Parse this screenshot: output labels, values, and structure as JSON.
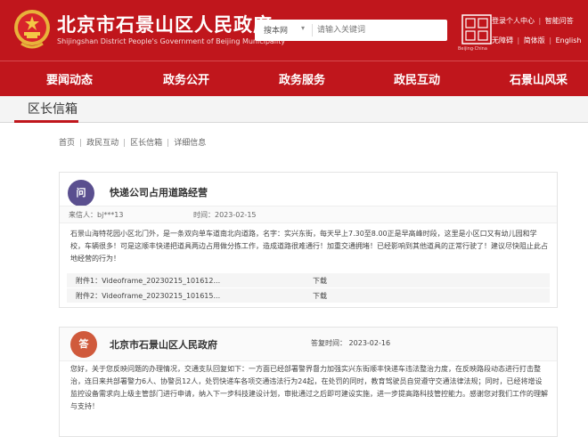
{
  "header": {
    "title": "北京市石景山区人民政府",
    "subtitle": "Shijingshan District People's Government of Beijing Municipality",
    "search": {
      "scope": "搜本网",
      "placeholder": "请输入关键词"
    },
    "city_logo_text": "Beijing·China",
    "links_row1": [
      "登录个人中心",
      "智能问答"
    ],
    "links_row2": [
      "无障碍",
      "简体版",
      "English"
    ]
  },
  "nav": {
    "items": [
      "要闻动态",
      "政务公开",
      "政务服务",
      "政民互动",
      "石景山风采"
    ]
  },
  "section": {
    "title": "区长信箱"
  },
  "breadcrumb": [
    "首页",
    "政民互动",
    "区长信箱",
    "详细信息"
  ],
  "letter": {
    "badge": "问",
    "title": "快递公司占用道路经营",
    "sender_label": "来信人：",
    "sender": "bj***13",
    "time_label": "时间：",
    "time": "2023-02-15",
    "body": "石景山海特花园小区北门外，是一条双向单车道南北向道路，名字：实兴东街，每天早上7.30至8.00正是早高峰时段，这里是小区口又有幼儿园和学校，车辆很多！可是这顺丰快递把道具两边占用做分拣工作，造成道路很难通行！加重交通拥堵！已经影响到其他道具的正常行驶了！建议尽快阻止此占地经营的行为！",
    "attachments": [
      {
        "label": "附件1：",
        "name": "Videoframe_20230215_101612...",
        "action": "下载"
      },
      {
        "label": "附件2：",
        "name": "Videoframe_20230215_101615...",
        "action": "下载"
      }
    ]
  },
  "reply": {
    "badge": "答",
    "org": "北京市石景山区人民政府",
    "time_label": "答复时间：",
    "time": "2023-02-16",
    "body": "您好，关于您反映问题的办理情况，交通支队回复如下：一方面已经部署警界督力加强实兴东街顺丰快递车违法整治力度，在反映路段动态进行打击整治，连日来共部署警力6人、协警员12人，处罚快递车各项交通违法行为24起，在处罚的同时，教育驾驶员自觉遵守交通法律法规；同时，已经将增设监控设备需求向上级主管部门进行申请，纳入下一步科技建设计划，审批通过之后即可建设实施，进一步提高路科技管控能力。感谢您对我们工作的理解与支持！"
  },
  "colors": {
    "brand_red": "#c0161c",
    "question_badge": "#5a4f8f",
    "answer_badge": "#d05a3c"
  }
}
